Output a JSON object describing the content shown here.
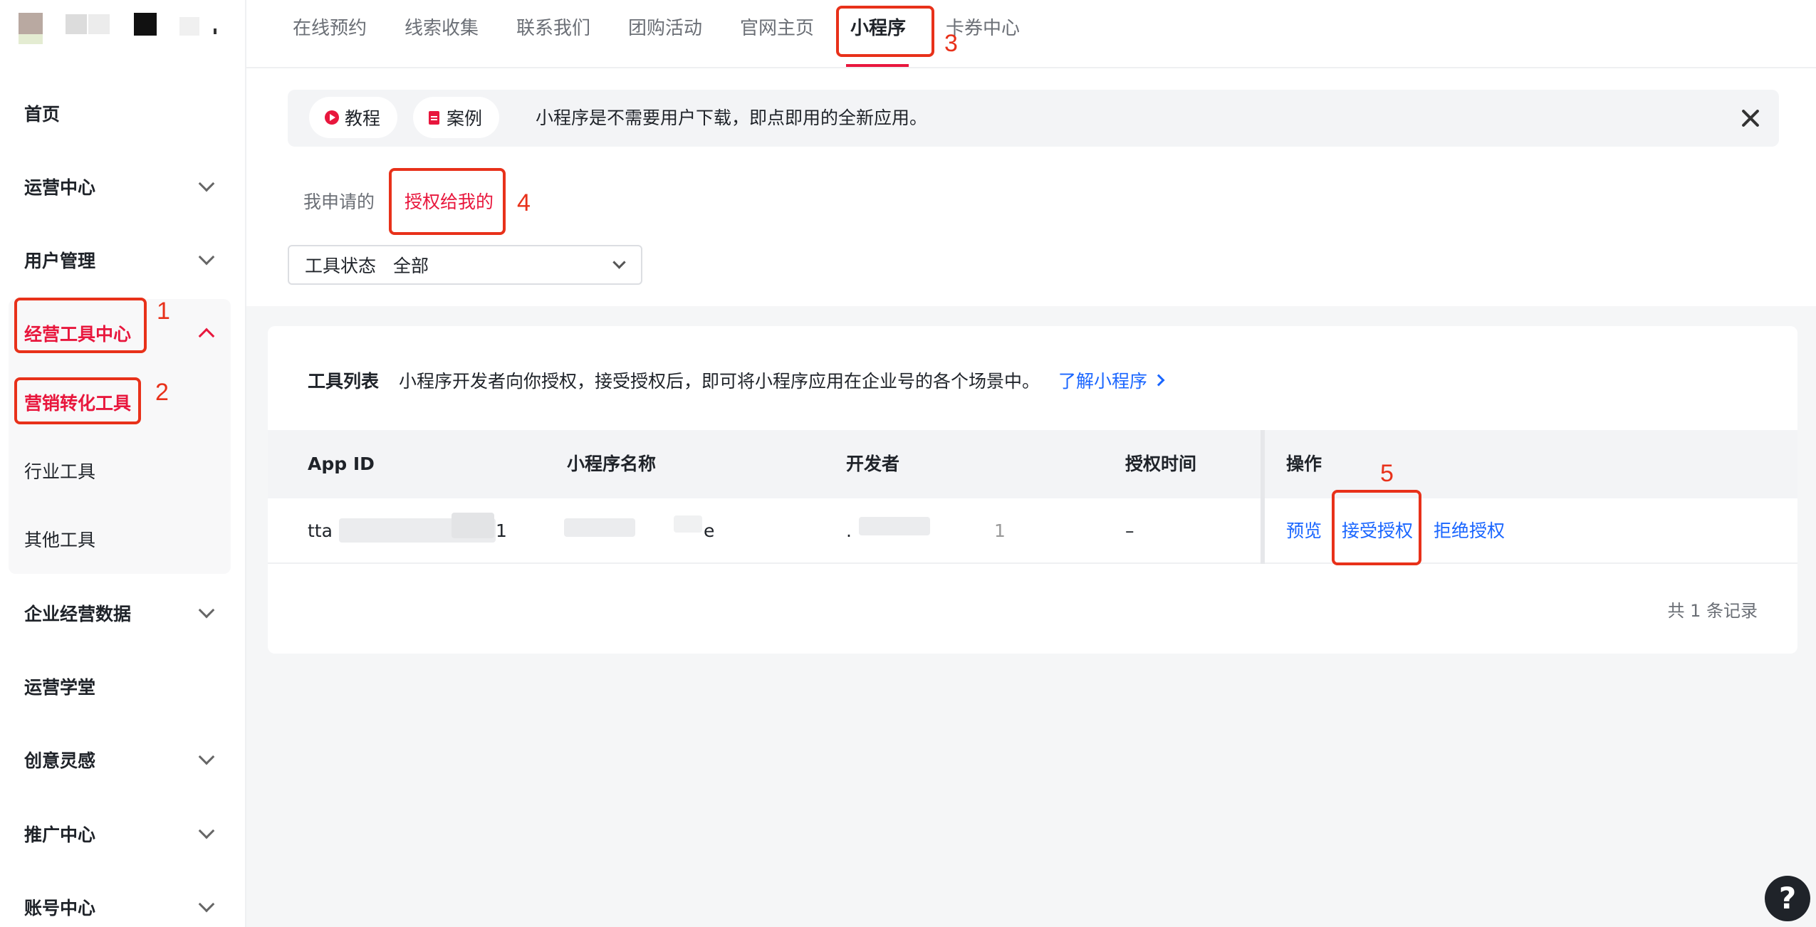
{
  "sidebar": {
    "items": [
      {
        "label": "首页"
      },
      {
        "label": "运营中心"
      },
      {
        "label": "用户管理"
      },
      {
        "label": "经营工具中心"
      },
      {
        "label": "企业经营数据"
      },
      {
        "label": "运营学堂"
      },
      {
        "label": "创意灵感"
      },
      {
        "label": "推广中心"
      },
      {
        "label": "账号中心"
      }
    ],
    "subitems": [
      {
        "label": "营销转化工具"
      },
      {
        "label": "行业工具"
      },
      {
        "label": "其他工具"
      }
    ]
  },
  "topnav": {
    "tabs": [
      {
        "label": "在线预约"
      },
      {
        "label": "线索收集"
      },
      {
        "label": "联系我们"
      },
      {
        "label": "团购活动"
      },
      {
        "label": "官网主页"
      },
      {
        "label": "小程序"
      },
      {
        "label": "卡券中心"
      }
    ],
    "active_tab": "小程序"
  },
  "banner": {
    "tutorial_label": "教程",
    "case_label": "案例",
    "text": "小程序是不需要用户下载，即点即用的全新应用。"
  },
  "subtabs": [
    {
      "label": "我申请的"
    },
    {
      "label": "授权给我的"
    }
  ],
  "filter": {
    "label": "工具状态",
    "value": "全部"
  },
  "card": {
    "title": "工具列表",
    "desc": "小程序开发者向你授权，接受授权后，即可将小程序应用在企业号的各个场景中。",
    "link": "了解小程序"
  },
  "table": {
    "headers": [
      "App ID",
      "小程序名称",
      "开发者",
      "授权时间",
      "操作"
    ],
    "rows": [
      {
        "app_id": "tta",
        "app_id_tail": "1",
        "name_tail": "e",
        "dev_head": ".",
        "dev_tail": "1",
        "auth_time": "–",
        "actions": [
          "预览",
          "接受授权",
          "拒绝授权"
        ]
      }
    ],
    "total_text": "共 1 条记录"
  },
  "annotations": [
    "1",
    "2",
    "3",
    "4",
    "5"
  ],
  "help_icon": "?",
  "colors": {
    "accent": "#e8173d",
    "link": "#1a66ff",
    "annotation": "#e8311a"
  }
}
